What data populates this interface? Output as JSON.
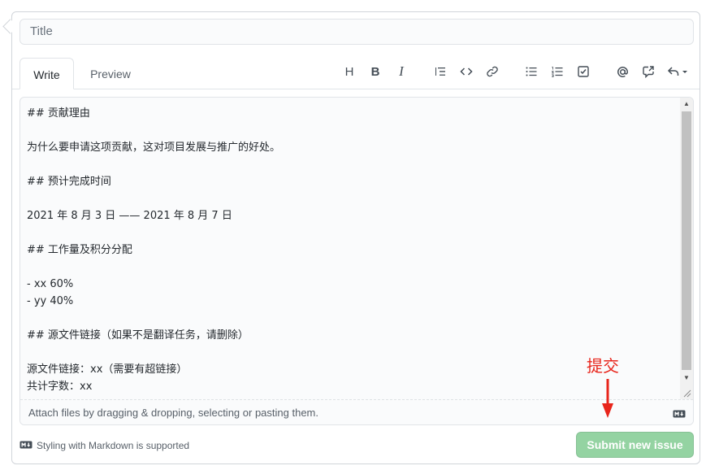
{
  "title_field": {
    "placeholder": "Title",
    "value": ""
  },
  "tabs": [
    {
      "label": "Write",
      "active": true
    },
    {
      "label": "Preview",
      "active": false
    }
  ],
  "toolbar": {
    "icons": [
      {
        "name": "heading-icon",
        "glyph": "H"
      },
      {
        "name": "bold-icon",
        "glyph": "B"
      },
      {
        "name": "italic-icon",
        "glyph": "I"
      },
      {
        "name": "quote-icon"
      },
      {
        "name": "code-icon"
      },
      {
        "name": "link-icon"
      },
      {
        "name": "unordered-list-icon"
      },
      {
        "name": "ordered-list-icon"
      },
      {
        "name": "task-list-icon"
      },
      {
        "name": "mention-icon"
      },
      {
        "name": "cross-reference-icon"
      },
      {
        "name": "saved-replies-icon"
      }
    ]
  },
  "editor": {
    "lines": [
      "## 贡献理由",
      "",
      "为什么要申请这项贡献，这对项目发展与推广的好处。",
      "",
      "## 预计完成时间",
      "",
      "2021 年 8 月 3 日 —— 2021 年 8 月 7 日",
      "",
      "## 工作量及积分分配",
      "",
      "- xx 60%",
      "- yy 40%",
      "",
      "## 源文件链接（如果不是翻译任务，请删除）",
      "",
      "源文件链接：xx（需要有超链接）",
      "共计字数：xx"
    ],
    "attach_hint": "Attach files by dragging & dropping, selecting or pasting them."
  },
  "annotation": {
    "text": "提交",
    "color": "#e8251b"
  },
  "footer": {
    "markdown_note": "Styling with Markdown is supported",
    "submit_label": "Submit new issue"
  },
  "colors": {
    "submit_disabled": "#94d3a2",
    "border": "#e1e4e8",
    "annotation": "#e8251b"
  }
}
